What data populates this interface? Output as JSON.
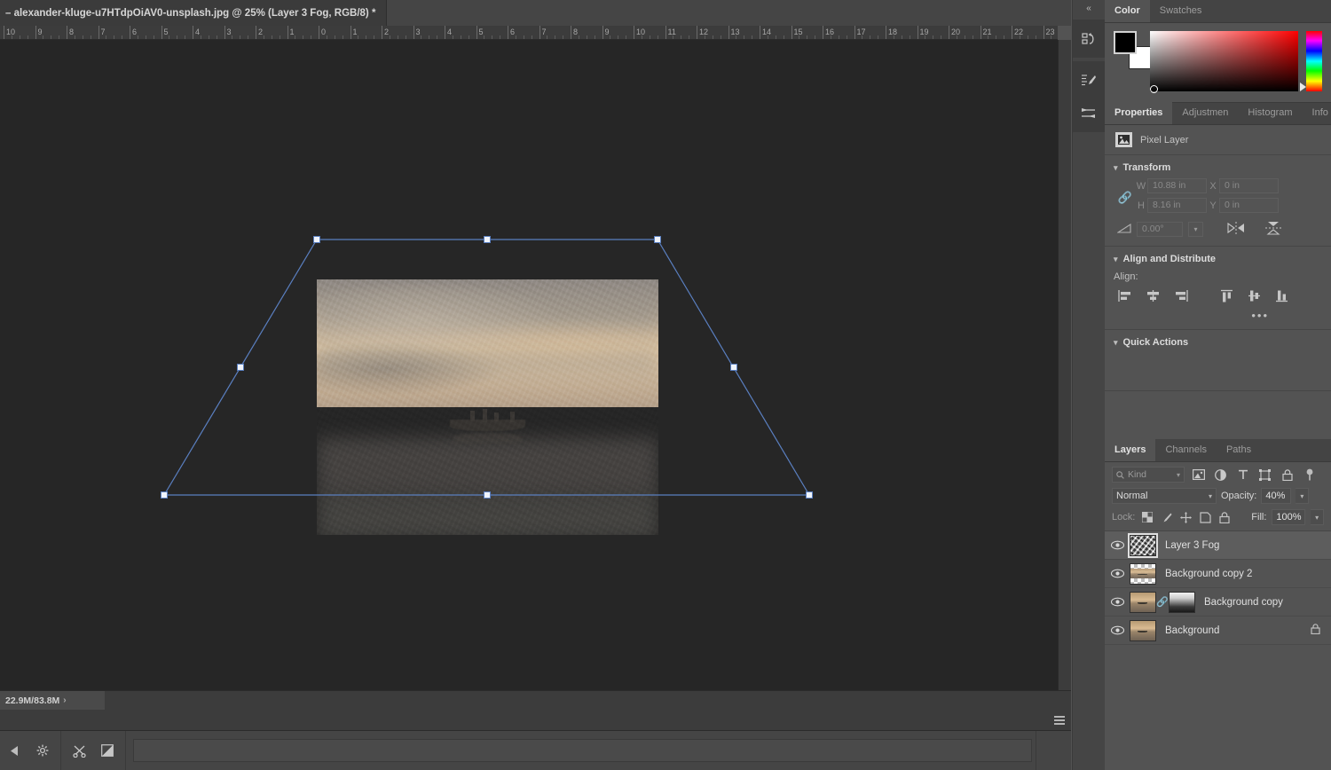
{
  "document": {
    "tab_title": "– alexander-kluge-u7HTdpOiAV0-unsplash.jpg @ 25% (Layer 3 Fog, RGB/8) *",
    "zoom": "25%",
    "color_mode": "RGB/8",
    "active_layer": "Layer 3 Fog"
  },
  "ruler": {
    "unit": "in",
    "labels": [
      "10",
      "9",
      "8",
      "7",
      "6",
      "5",
      "4",
      "3",
      "2",
      "1",
      "0",
      "1",
      "2",
      "3",
      "4",
      "5",
      "6",
      "7",
      "8",
      "9",
      "10",
      "11",
      "12",
      "13",
      "14",
      "15",
      "16",
      "17",
      "18",
      "19",
      "20",
      "21",
      "22",
      "23"
    ]
  },
  "status": {
    "doc_size": "22.9M/83.8M",
    "arrow": "›"
  },
  "rail": {
    "collapse": "«",
    "items": [
      {
        "name": "history-icon",
        "label": "History"
      },
      {
        "name": "brush-settings-icon",
        "label": "Brush Settings"
      },
      {
        "name": "adjustments-icon",
        "label": "Adjustments"
      }
    ]
  },
  "color_panel": {
    "tabs": [
      {
        "label": "Color",
        "active": true
      },
      {
        "label": "Swatches",
        "active": false
      }
    ],
    "foreground": "#000000",
    "background": "#ffffff",
    "field_hue": "#ff0000"
  },
  "properties_panel": {
    "tabs": [
      {
        "label": "Properties",
        "active": true
      },
      {
        "label": "Adjustmen",
        "active": false
      },
      {
        "label": "Histogram",
        "active": false
      },
      {
        "label": "Info",
        "active": false
      }
    ],
    "layer_type": "Pixel Layer",
    "transform": {
      "title": "Transform",
      "w_label": "W",
      "w_value": "10.88 in",
      "h_label": "H",
      "h_value": "8.16 in",
      "x_label": "X",
      "x_value": "0 in",
      "y_label": "Y",
      "y_value": "0 in",
      "angle_value": "0.00°"
    },
    "align": {
      "title": "Align and Distribute",
      "label": "Align:",
      "buttons": [
        "align-left-icon",
        "align-center-horizontal-icon",
        "align-right-icon",
        "align-top-icon",
        "align-middle-vertical-icon",
        "align-bottom-icon"
      ],
      "more": "•••"
    },
    "quick_actions": {
      "title": "Quick Actions"
    }
  },
  "layers_panel": {
    "tabs": [
      {
        "label": "Layers",
        "active": true
      },
      {
        "label": "Channels",
        "active": false
      },
      {
        "label": "Paths",
        "active": false
      }
    ],
    "filter": {
      "kind_placeholder": "Kind",
      "icons": [
        "pixel-filter-icon",
        "adjustment-filter-icon",
        "type-filter-icon",
        "shape-filter-icon",
        "smart-object-filter-icon",
        "filter-toggle-icon"
      ]
    },
    "blend_mode": "Normal",
    "opacity_label": "Opacity:",
    "opacity_value": "40%",
    "lock_label": "Lock:",
    "lock_icons": [
      "lock-transparency-icon",
      "lock-pixels-icon",
      "lock-position-icon",
      "lock-artboard-icon",
      "lock-all-icon"
    ],
    "fill_label": "Fill:",
    "fill_value": "100%",
    "layers": [
      {
        "name": "Layer 3 Fog",
        "visible": true,
        "selected": true,
        "thumb": "fog",
        "has_mask": false,
        "locked": false
      },
      {
        "name": "Background copy 2",
        "visible": true,
        "selected": false,
        "thumb": "transparent-photo",
        "has_mask": false,
        "locked": false
      },
      {
        "name": "Background copy",
        "visible": true,
        "selected": false,
        "thumb": "photo",
        "has_mask": true,
        "locked": false
      },
      {
        "name": "Background",
        "visible": true,
        "selected": false,
        "thumb": "photo",
        "has_mask": false,
        "locked": true
      }
    ]
  },
  "bottom_bar": {
    "buttons": [
      "play-back-icon",
      "gear-icon",
      "scissors-icon",
      "split-square-icon"
    ],
    "menu": "timeline-menu-icon"
  },
  "colors": {
    "panel_bg": "#535353",
    "canvas_bg": "#262626",
    "tab_bg": "#454545",
    "selection_blue": "#5a7fc0",
    "handle_fill": "#f0f4fb"
  }
}
